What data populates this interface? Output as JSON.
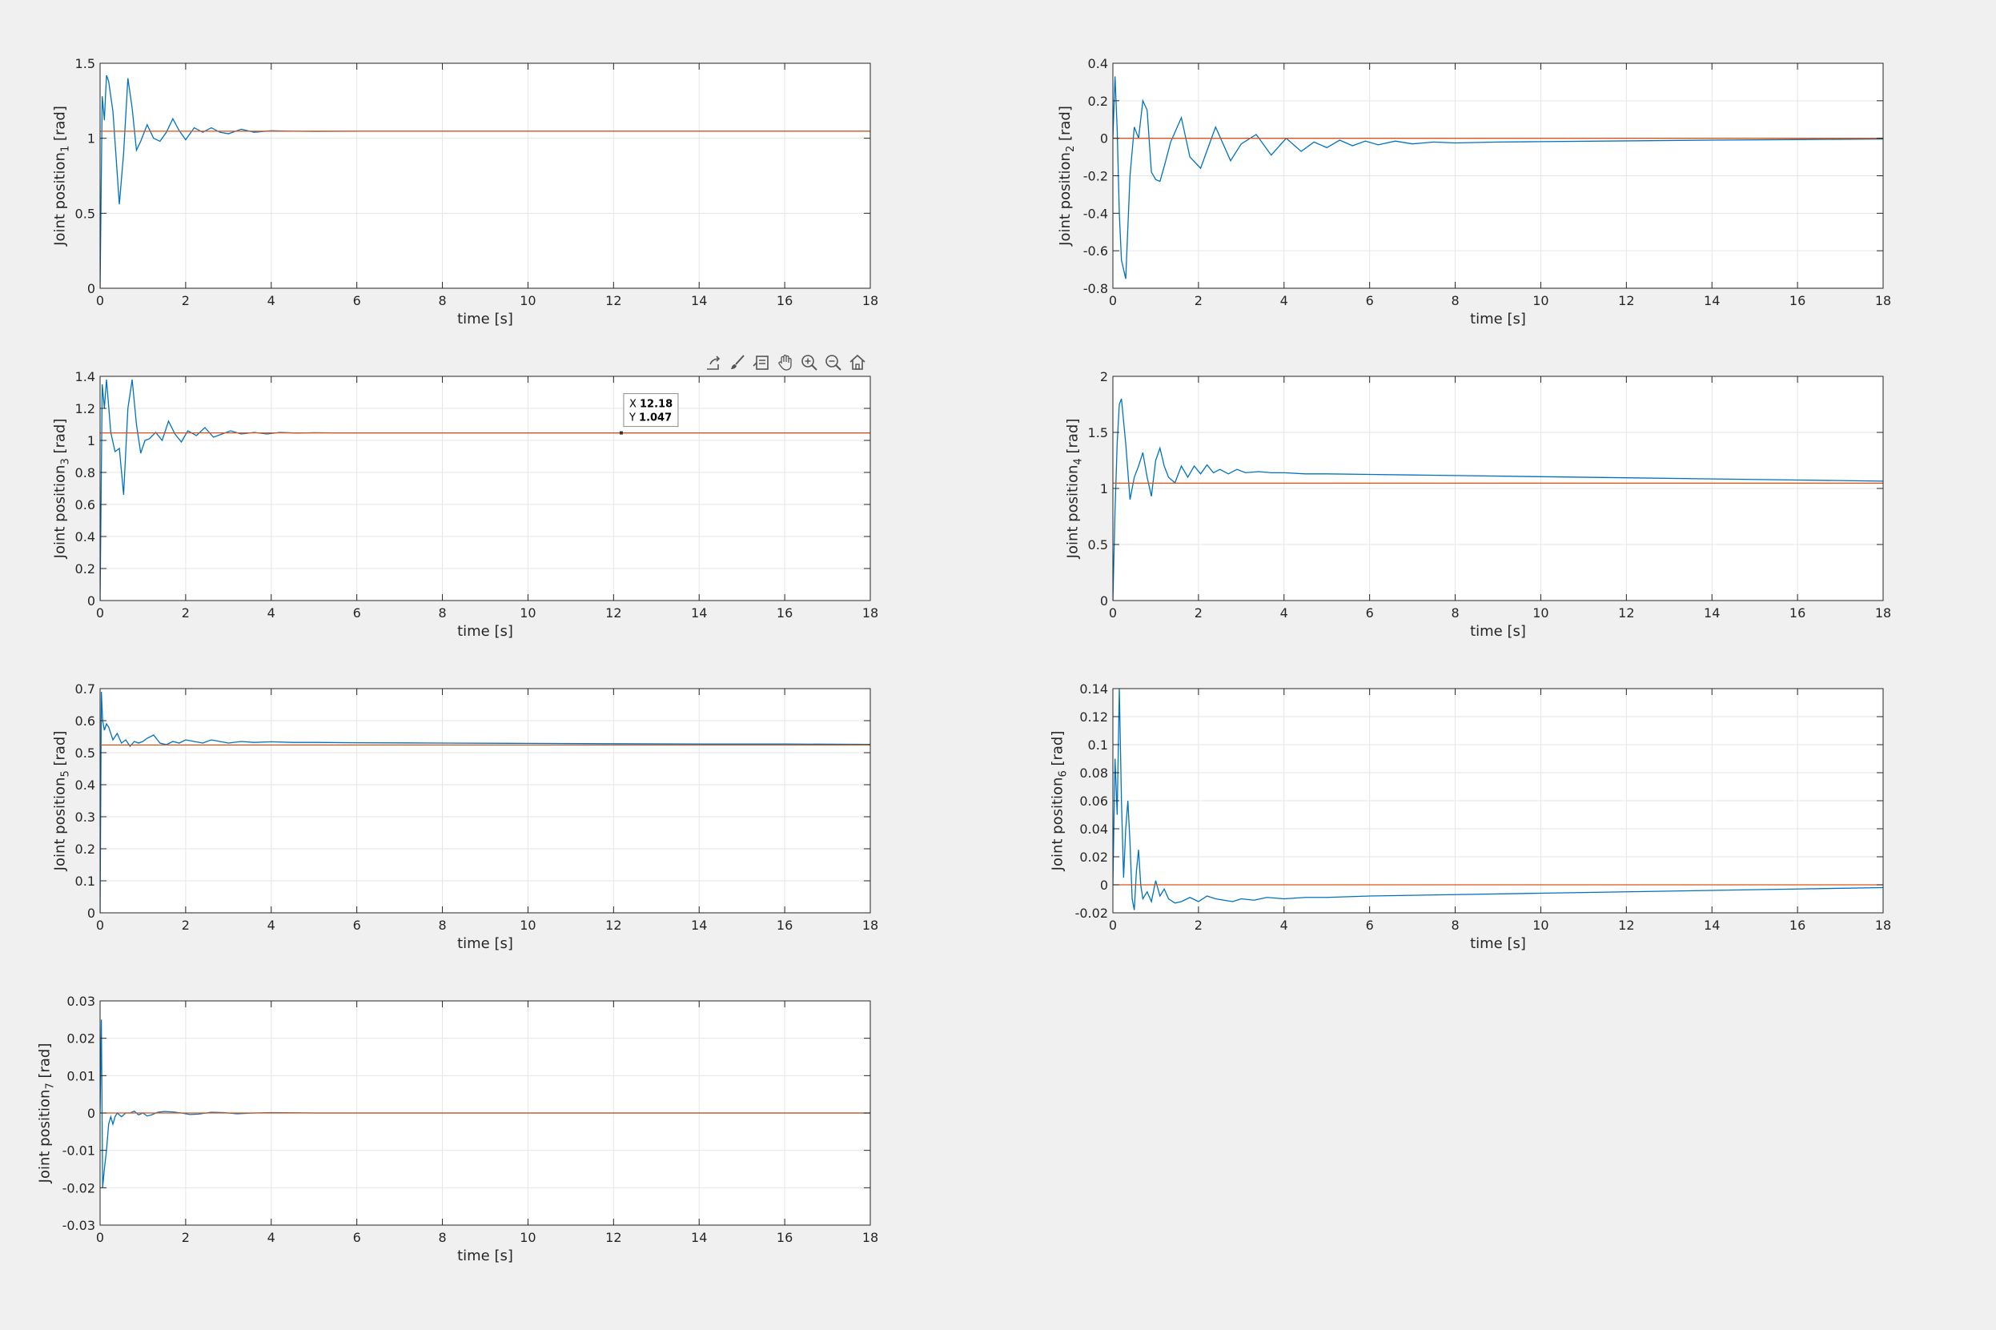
{
  "toolbar": {
    "icons": [
      "export-icon",
      "brush-icon",
      "data-tips-icon",
      "pan-icon",
      "zoom-in-icon",
      "zoom-out-icon",
      "home-icon"
    ]
  },
  "datatip": {
    "x_label": "X",
    "x_value": "12.18",
    "y_label": "Y",
    "y_value": "1.047",
    "plot_index": 2
  },
  "colors": {
    "response": "#0072BD",
    "reference": "#D95319",
    "grid": "#e6e6e6",
    "axes_bg": "#ffffff",
    "figure_bg": "#f0f0f0"
  },
  "chart_data": [
    {
      "type": "line",
      "ylabel_main": "Joint position",
      "ylabel_sub": "1",
      "ylabel_unit": "[rad]",
      "xlabel": "time [s]",
      "xlim": [
        0,
        18
      ],
      "ylim": [
        0,
        1.5
      ],
      "xticks": [
        "0",
        "2",
        "4",
        "6",
        "8",
        "10",
        "12",
        "14",
        "16",
        "18"
      ],
      "yticks": [
        "0",
        "0.5",
        "1",
        "1.5"
      ],
      "grid": true,
      "series": [
        {
          "x": [
            0,
            0.05,
            0.1,
            0.15,
            0.2,
            0.3,
            0.45,
            0.55,
            0.65,
            0.75,
            0.85,
            0.95,
            1.1,
            1.25,
            1.4,
            1.55,
            1.7,
            1.85,
            2.0,
            2.2,
            2.4,
            2.6,
            2.8,
            3.0,
            3.3,
            3.6,
            4.0,
            4.5,
            5.0,
            6.0,
            7.0,
            8.0,
            10.0,
            12.0,
            14.0,
            16.0,
            18.0
          ],
          "y": [
            0,
            1.28,
            1.12,
            1.42,
            1.38,
            1.18,
            0.56,
            0.9,
            1.4,
            1.2,
            0.92,
            0.98,
            1.09,
            1.0,
            0.98,
            1.04,
            1.13,
            1.05,
            0.99,
            1.07,
            1.04,
            1.07,
            1.04,
            1.03,
            1.06,
            1.04,
            1.05,
            1.047,
            1.046,
            1.047,
            1.047,
            1.047,
            1.047,
            1.047,
            1.047,
            1.047,
            1.047
          ]
        },
        {
          "x": [
            0,
            18
          ],
          "y": [
            1.047,
            1.047
          ]
        }
      ]
    },
    {
      "type": "line",
      "ylabel_main": "Joint position",
      "ylabel_sub": "2",
      "ylabel_unit": "[rad]",
      "xlabel": "time [s]",
      "xlim": [
        0,
        18
      ],
      "ylim": [
        -0.8,
        0.4
      ],
      "xticks": [
        "0",
        "2",
        "4",
        "6",
        "8",
        "10",
        "12",
        "14",
        "16",
        "18"
      ],
      "yticks": [
        "-0.8",
        "-0.6",
        "-0.4",
        "-0.2",
        "0",
        "0.2",
        "0.4"
      ],
      "grid": true,
      "series": [
        {
          "x": [
            0,
            0.05,
            0.1,
            0.15,
            0.2,
            0.3,
            0.4,
            0.5,
            0.6,
            0.7,
            0.8,
            0.9,
            1.0,
            1.1,
            1.2,
            1.35,
            1.6,
            1.8,
            2.05,
            2.4,
            2.75,
            3.0,
            3.35,
            3.7,
            4.05,
            4.4,
            4.7,
            5.0,
            5.3,
            5.6,
            5.9,
            6.2,
            6.6,
            7.0,
            7.5,
            8.0,
            9.0,
            10.0,
            12.0,
            14.0,
            16.0,
            18.0
          ],
          "y": [
            0,
            0.33,
            0.05,
            -0.4,
            -0.65,
            -0.75,
            -0.2,
            0.06,
            0.0,
            0.2,
            0.15,
            -0.18,
            -0.22,
            -0.23,
            -0.15,
            -0.02,
            0.11,
            -0.1,
            -0.16,
            0.06,
            -0.12,
            -0.03,
            0.02,
            -0.09,
            0.0,
            -0.07,
            -0.02,
            -0.05,
            -0.01,
            -0.04,
            -0.015,
            -0.035,
            -0.015,
            -0.03,
            -0.02,
            -0.025,
            -0.02,
            -0.018,
            -0.014,
            -0.01,
            -0.007,
            -0.004
          ]
        },
        {
          "x": [
            0,
            18
          ],
          "y": [
            0,
            0
          ]
        }
      ]
    },
    {
      "type": "line",
      "ylabel_main": "Joint position",
      "ylabel_sub": "3",
      "ylabel_unit": "[rad]",
      "xlabel": "time [s]",
      "xlim": [
        0,
        18
      ],
      "ylim": [
        0,
        1.4
      ],
      "xticks": [
        "0",
        "2",
        "4",
        "6",
        "8",
        "10",
        "12",
        "14",
        "16",
        "18"
      ],
      "yticks": [
        "0",
        "0.2",
        "0.4",
        "0.6",
        "0.8",
        "1",
        "1.2",
        "1.4"
      ],
      "grid": true,
      "series": [
        {
          "x": [
            0,
            0.05,
            0.1,
            0.15,
            0.25,
            0.35,
            0.45,
            0.55,
            0.65,
            0.75,
            0.85,
            0.95,
            1.05,
            1.15,
            1.3,
            1.45,
            1.6,
            1.75,
            1.9,
            2.05,
            2.25,
            2.45,
            2.65,
            2.85,
            3.05,
            3.3,
            3.6,
            3.9,
            4.2,
            4.6,
            5.0,
            5.5,
            6.0,
            7.0,
            8.0,
            10.0,
            12.0,
            14.0,
            16.0,
            18.0
          ],
          "y": [
            0,
            1.35,
            1.2,
            1.38,
            1.05,
            0.93,
            0.95,
            0.66,
            1.2,
            1.38,
            1.1,
            0.92,
            1.0,
            1.01,
            1.05,
            1.0,
            1.12,
            1.04,
            0.99,
            1.06,
            1.03,
            1.08,
            1.02,
            1.04,
            1.06,
            1.04,
            1.05,
            1.04,
            1.05,
            1.046,
            1.048,
            1.047,
            1.047,
            1.047,
            1.047,
            1.047,
            1.047,
            1.047,
            1.047,
            1.047
          ]
        },
        {
          "x": [
            0,
            18
          ],
          "y": [
            1.047,
            1.047
          ]
        }
      ]
    },
    {
      "type": "line",
      "ylabel_main": "Joint position",
      "ylabel_sub": "4",
      "ylabel_unit": "[rad]",
      "xlabel": "time [s]",
      "xlim": [
        0,
        18
      ],
      "ylim": [
        0,
        2
      ],
      "xticks": [
        "0",
        "2",
        "4",
        "6",
        "8",
        "10",
        "12",
        "14",
        "16",
        "18"
      ],
      "yticks": [
        "0",
        "0.5",
        "1",
        "1.5",
        "2"
      ],
      "grid": true,
      "series": [
        {
          "x": [
            0,
            0.05,
            0.1,
            0.15,
            0.2,
            0.3,
            0.4,
            0.5,
            0.6,
            0.7,
            0.8,
            0.9,
            1.0,
            1.1,
            1.2,
            1.3,
            1.45,
            1.6,
            1.75,
            1.9,
            2.05,
            2.2,
            2.35,
            2.5,
            2.7,
            2.9,
            3.1,
            3.4,
            3.7,
            4.0,
            4.5,
            5.0,
            6.0,
            7.0,
            8.0,
            10.0,
            12.0,
            14.0,
            16.0,
            18.0
          ],
          "y": [
            0,
            0.8,
            1.4,
            1.75,
            1.8,
            1.4,
            0.9,
            1.1,
            1.2,
            1.32,
            1.1,
            0.93,
            1.25,
            1.36,
            1.2,
            1.1,
            1.05,
            1.2,
            1.1,
            1.2,
            1.13,
            1.21,
            1.14,
            1.17,
            1.13,
            1.17,
            1.14,
            1.15,
            1.14,
            1.14,
            1.13,
            1.13,
            1.125,
            1.12,
            1.115,
            1.105,
            1.095,
            1.085,
            1.075,
            1.065
          ]
        },
        {
          "x": [
            0,
            18
          ],
          "y": [
            1.047,
            1.047
          ]
        }
      ]
    },
    {
      "type": "line",
      "ylabel_main": "Joint position",
      "ylabel_sub": "5",
      "ylabel_unit": "[rad]",
      "xlabel": "time [s]",
      "xlim": [
        0,
        18
      ],
      "ylim": [
        0,
        0.7
      ],
      "xticks": [
        "0",
        "2",
        "4",
        "6",
        "8",
        "10",
        "12",
        "14",
        "16",
        "18"
      ],
      "yticks": [
        "0",
        "0.1",
        "0.2",
        "0.3",
        "0.4",
        "0.5",
        "0.6",
        "0.7"
      ],
      "grid": true,
      "series": [
        {
          "x": [
            0,
            0.03,
            0.06,
            0.1,
            0.15,
            0.2,
            0.3,
            0.4,
            0.5,
            0.6,
            0.7,
            0.8,
            0.9,
            1.0,
            1.1,
            1.25,
            1.4,
            1.55,
            1.7,
            1.85,
            2.0,
            2.2,
            2.4,
            2.6,
            2.8,
            3.0,
            3.3,
            3.6,
            4.0,
            4.5,
            5.0,
            6.0,
            8.0,
            10.0,
            12.0,
            14.0,
            16.0,
            18.0
          ],
          "y": [
            0,
            0.69,
            0.6,
            0.57,
            0.59,
            0.58,
            0.54,
            0.56,
            0.53,
            0.54,
            0.52,
            0.535,
            0.53,
            0.535,
            0.545,
            0.555,
            0.53,
            0.525,
            0.535,
            0.53,
            0.54,
            0.535,
            0.53,
            0.54,
            0.535,
            0.53,
            0.535,
            0.532,
            0.534,
            0.532,
            0.532,
            0.531,
            0.53,
            0.529,
            0.528,
            0.527,
            0.527,
            0.526
          ]
        },
        {
          "x": [
            0,
            18
          ],
          "y": [
            0.524,
            0.524
          ]
        }
      ]
    },
    {
      "type": "line",
      "ylabel_main": "Joint position",
      "ylabel_sub": "6",
      "ylabel_unit": "[rad]",
      "xlabel": "time [s]",
      "xlim": [
        0,
        18
      ],
      "ylim": [
        -0.02,
        0.14
      ],
      "xticks": [
        "0",
        "2",
        "4",
        "6",
        "8",
        "10",
        "12",
        "14",
        "16",
        "18"
      ],
      "yticks": [
        "-0.02",
        "0",
        "0.02",
        "0.04",
        "0.06",
        "0.08",
        "0.1",
        "0.12",
        "0.14"
      ],
      "grid": true,
      "series": [
        {
          "x": [
            0,
            0.05,
            0.1,
            0.15,
            0.2,
            0.25,
            0.3,
            0.35,
            0.4,
            0.45,
            0.5,
            0.55,
            0.6,
            0.65,
            0.7,
            0.8,
            0.9,
            1.0,
            1.1,
            1.2,
            1.3,
            1.45,
            1.6,
            1.8,
            2.0,
            2.2,
            2.4,
            2.6,
            2.8,
            3.0,
            3.3,
            3.6,
            4.0,
            4.5,
            5.0,
            6.0,
            8.0,
            10.0,
            12.0,
            14.0,
            16.0,
            18.0
          ],
          "y": [
            0,
            0.09,
            0.05,
            0.14,
            0.06,
            0.005,
            0.04,
            0.06,
            0.03,
            -0.01,
            -0.018,
            0.01,
            0.025,
            0.0,
            -0.01,
            -0.005,
            -0.012,
            0.003,
            -0.008,
            -0.003,
            -0.01,
            -0.013,
            -0.012,
            -0.009,
            -0.012,
            -0.008,
            -0.01,
            -0.011,
            -0.012,
            -0.01,
            -0.011,
            -0.009,
            -0.01,
            -0.009,
            -0.009,
            -0.008,
            -0.007,
            -0.006,
            -0.005,
            -0.004,
            -0.003,
            -0.002
          ]
        },
        {
          "x": [
            0,
            18
          ],
          "y": [
            0,
            0
          ]
        }
      ]
    },
    {
      "type": "line",
      "ylabel_main": "Joint position",
      "ylabel_sub": "7",
      "ylabel_unit": "[rad]",
      "xlabel": "time [s]",
      "xlim": [
        0,
        18
      ],
      "ylim": [
        -0.03,
        0.03
      ],
      "xticks": [
        "0",
        "2",
        "4",
        "6",
        "8",
        "10",
        "12",
        "14",
        "16",
        "18"
      ],
      "yticks": [
        "-0.03",
        "-0.02",
        "-0.01",
        "0",
        "0.01",
        "0.02",
        "0.03"
      ],
      "grid": true,
      "series": [
        {
          "x": [
            0,
            0.03,
            0.06,
            0.1,
            0.15,
            0.2,
            0.25,
            0.3,
            0.35,
            0.4,
            0.5,
            0.6,
            0.7,
            0.8,
            0.9,
            1.0,
            1.1,
            1.2,
            1.35,
            1.5,
            1.7,
            1.9,
            2.1,
            2.3,
            2.6,
            2.9,
            3.2,
            3.6,
            4.0,
            5.0,
            6.0,
            8.0,
            10.0,
            12.0,
            14.0,
            16.0,
            18.0
          ],
          "y": [
            0,
            0.025,
            -0.02,
            -0.015,
            -0.01,
            -0.003,
            -0.001,
            -0.003,
            -0.001,
            0.0,
            -0.001,
            0.0,
            0.0,
            0.0005,
            -0.0005,
            0.0,
            -0.0008,
            -0.0005,
            0.0002,
            0.0004,
            0.0003,
            0.0,
            -0.0004,
            -0.0003,
            0.0002,
            0.0001,
            -0.0002,
            0.0,
            0.0001,
            0.0,
            0.0,
            0.0,
            0.0,
            0.0,
            0.0,
            0.0,
            0.0
          ]
        },
        {
          "x": [
            0,
            18
          ],
          "y": [
            0,
            0
          ]
        }
      ]
    }
  ]
}
